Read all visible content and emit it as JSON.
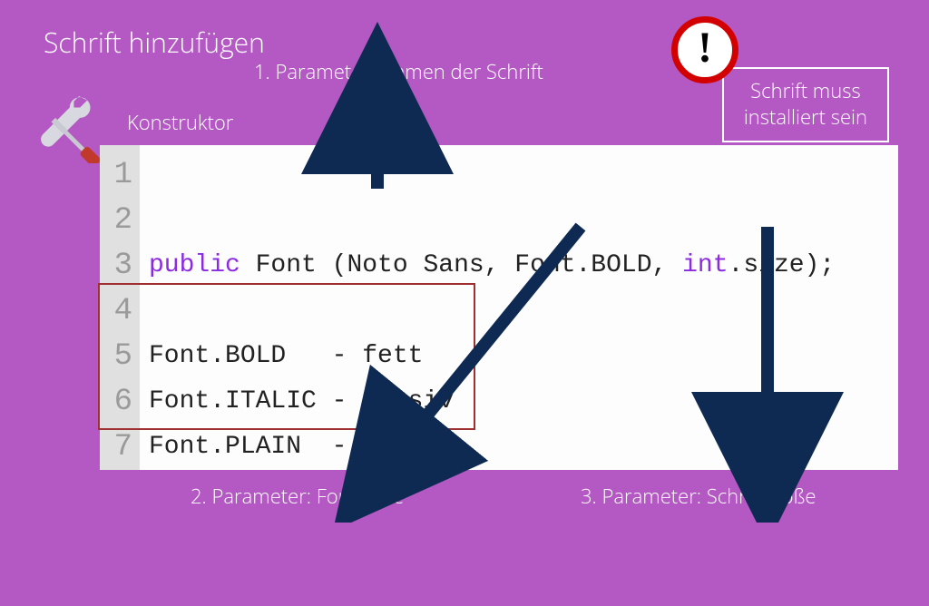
{
  "title": "Schrift hinzufügen",
  "konstruktor_label": "Konstruktor",
  "param1_label": "1. Parameter: Namen der Schrift",
  "param2_label": "2. Parameter: Font Style",
  "param3_label": "3. Parameter: Schriftgröße",
  "warning_line1": "Schrift muss",
  "warning_line2": "installiert sein",
  "exclaim": "!",
  "gutter": [
    "1",
    "2",
    "3",
    "4",
    "5",
    "6",
    "7"
  ],
  "code": {
    "kw_public": "public",
    "const_mid": " Font (Noto Sans, Font.BOLD, ",
    "kw_int": "int",
    "const_tail": ".size);",
    "style_bold": "Font.BOLD   - fett",
    "style_italic": "Font.ITALIC - kursiv",
    "style_plain": "Font.PLAIN  - normal"
  },
  "icons": {
    "tools": "tools-icon",
    "warning": "warning-icon"
  },
  "colors": {
    "bg": "#b459c4",
    "arrow": "#0f2a52",
    "keyword": "#8a2be2",
    "warn_ring": "#d30000",
    "box_border": "#a03030"
  }
}
